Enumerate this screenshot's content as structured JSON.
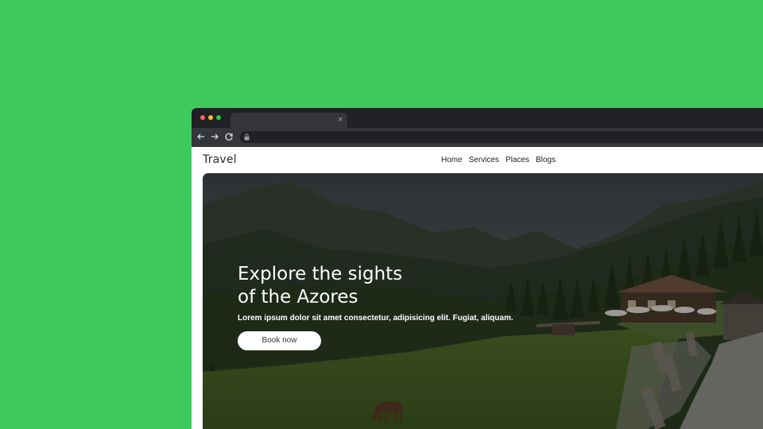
{
  "browser": {
    "tab_close": "×"
  },
  "site": {
    "brand": "Travel",
    "nav": [
      "Home",
      "Services",
      "Places",
      "Blogs"
    ]
  },
  "hero": {
    "title_line1": "Explore the sights",
    "title_line2": "of the Azores",
    "subtitle": "Lorem ipsum dolor sit amet consectetur, adipisicing elit. Fugiat, aliquam.",
    "cta_label": "Book now"
  },
  "colors": {
    "page_background": "#3fc85c",
    "browser_chrome": "#202124",
    "toolbar": "#35363a",
    "hero_overlay": "#000000"
  },
  "icons": [
    "back-arrow-icon",
    "forward-arrow-icon",
    "reload-icon",
    "lock-icon",
    "close-icon"
  ]
}
